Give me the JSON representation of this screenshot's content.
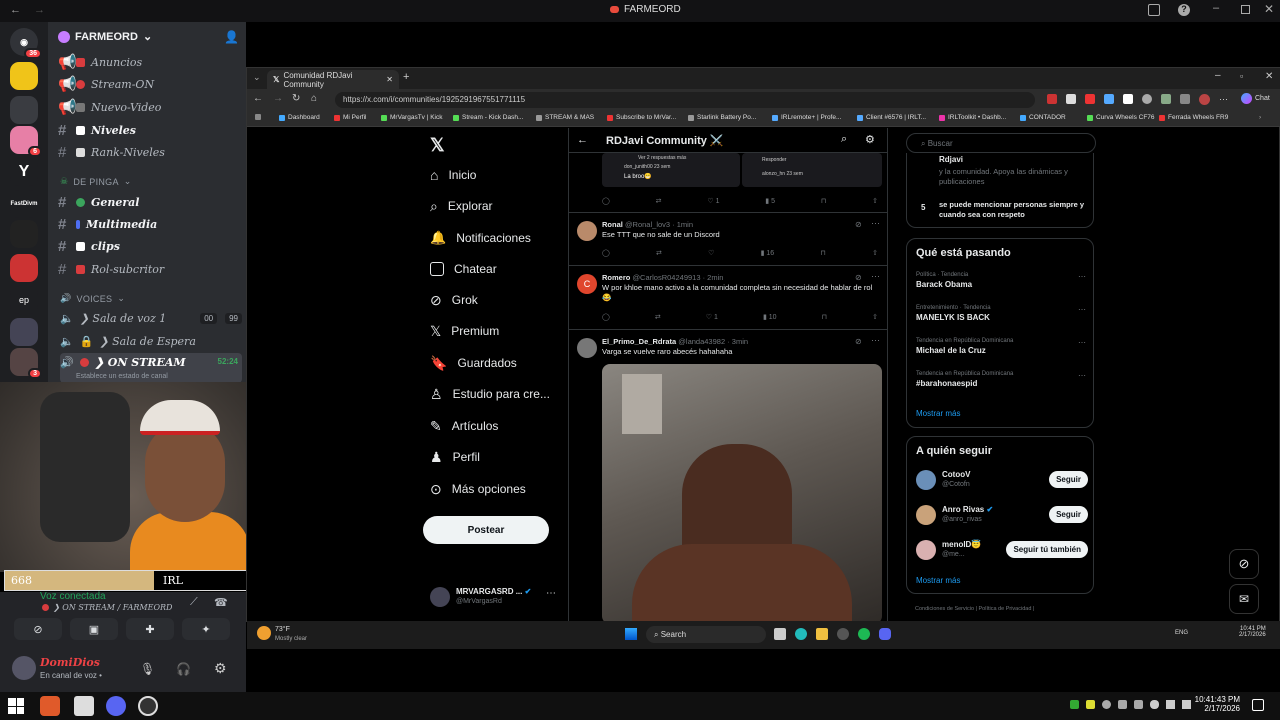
{
  "window": {
    "title": "FARMEORD"
  },
  "discord": {
    "server_name": "FARMEORD",
    "servers": [
      {
        "badge": "36"
      },
      {
        "badge": ""
      },
      {
        "badge": ""
      },
      {
        "badge": "6"
      },
      {
        "badge": ""
      },
      {
        "badge": ""
      },
      {
        "badge": ""
      },
      {
        "badge": ""
      },
      {
        "badge": ""
      },
      {
        "badge": ""
      },
      {
        "badge": "3"
      }
    ],
    "server_texts": {
      "ep": "ep",
      "fast": "FastDivm"
    },
    "channels": [
      {
        "name": "Anuncios",
        "emoji_color": "#d83c3e"
      },
      {
        "name": "Stream-ON",
        "emoji_color": "#d83c3e"
      },
      {
        "name": "Nuevo-Video",
        "emoji_color": "#aaaaaa"
      },
      {
        "name": "Niveles",
        "emoji_color": "#ffffff",
        "bold": true
      },
      {
        "name": "Rank-Niveles",
        "emoji_color": "#ffffff"
      }
    ],
    "category1": "DE PINGA",
    "channels2": [
      {
        "name": "General",
        "emoji_color": "#3ba55d",
        "bold": true
      },
      {
        "name": "Multimedia",
        "emoji_color": "#4e6ef2",
        "bold": true
      },
      {
        "name": "clips",
        "emoji_color": "#ffffff",
        "bold": true
      },
      {
        "name": "Rol-subcritor",
        "emoji_color": "#d83c3e"
      }
    ],
    "category2": "VOICES",
    "voice": [
      {
        "name": "❯ Sala de voz 1",
        "pill1": "00",
        "pill2": "99"
      },
      {
        "name": "❯ Sala de Espera"
      },
      {
        "name": "❯ ON STREAM",
        "time": "52:24",
        "status": "Establece un estado de canal"
      }
    ],
    "voice_status": "Voz conectada",
    "voice_channel": "❯ ON STREAM / FARMEORD",
    "user_name": "DomiDios",
    "user_status": "En canal de voz •"
  },
  "progress": {
    "left": "668",
    "center": "IRL",
    "right": "1000",
    "value": 668,
    "max": 1000
  },
  "browser": {
    "tab_title": "Comunidad RDJavi Community",
    "url": "https://x.com/i/communities/1925291967551771115",
    "chat": "Chat",
    "bookmarks": [
      "Dashboard",
      "Mi Perfil",
      "MrVargasTv | Kick",
      "Stream - Kick Dash...",
      "STREAM & MAS",
      "Subscribe to MrVar...",
      "Starlink Battery Po...",
      "IRLremote+ | Profe...",
      "Client #6576 | IRLT...",
      "IRLToolkit • Dashb...",
      "CONTADOR",
      "Curva Wheels CF76",
      "Ferrada Wheels FR9"
    ]
  },
  "x": {
    "nav": [
      "Inicio",
      "Explorar",
      "Notificaciones",
      "Chatear",
      "Grok",
      "Premium",
      "Guardados",
      "Estudio para cre...",
      "Artículos",
      "Perfil",
      "Más opciones"
    ],
    "post_button": "Postear",
    "account_name": "MRVARGASRD ...",
    "account_handle": "@MrVargasRd",
    "community_title": "RDJavi Community ⚔️",
    "top_preview": {
      "replies": "Ver 2 respuestas más",
      "u1": "don_junith00 23 sem",
      "t1": "La broo😁",
      "u2": "alonzo_hn 23 sem",
      "resp": "Responder",
      "likes": "1",
      "views": "5"
    },
    "tweets": [
      {
        "name": "Ronal",
        "handle": "@Ronal_lov3 · 1min",
        "text": "Ese TTT que no sale de un Discord",
        "likes": "",
        "views": "16"
      },
      {
        "name": "Romero",
        "handle": "@CarlosR04249913 · 2min",
        "text": "W por khloe mano activo a la comunidad completa sin necesidad de hablar de rol 😂",
        "likes": "1",
        "views": "10"
      },
      {
        "name": "El_Primo_De_Rdrata",
        "handle": "@landa43982 · 3min",
        "text": "Varga se vuelve raro abecés hahahaha"
      }
    ],
    "search_placeholder": "Buscar",
    "rules": {
      "r_name": "Rdjavi",
      "r_text": "y la comunidad. Apoya las dinámicas y publicaciones",
      "num": "5",
      "rule5": "se puede mencionar personas siempre y cuando sea con respeto"
    },
    "trending_title": "Qué está pasando",
    "trends": [
      {
        "cat": "Política · Tendencia",
        "name": "Barack Obama"
      },
      {
        "cat": "Entretenimiento · Tendencia",
        "name": "MANELYK IS BACK"
      },
      {
        "cat": "Tendencia en República Dominicana",
        "name": "Michael de la Cruz"
      },
      {
        "cat": "Tendencia en República Dominicana",
        "name": "#barahonaespid"
      }
    ],
    "show_more": "Mostrar más",
    "wtf_title": "A quién seguir",
    "wtf": [
      {
        "name": "CotooV",
        "handle": "@Cotofn",
        "btn": "Seguir"
      },
      {
        "name": "Anro Rivas",
        "handle": "@anro_rivas",
        "btn": "Seguir"
      },
      {
        "name": "menolD😇",
        "handle": "@me...",
        "btn": "Seguir tú también"
      }
    ],
    "show_more2": "Mostrar más",
    "footer": "Condiciones de Servicio  |  Política de Privacidad  |"
  },
  "inner_taskbar": {
    "temp": "73°F",
    "weather": "Mostly clear",
    "search": "Search",
    "lang": "ENG",
    "time": "10:41 PM",
    "date": "2/17/2026"
  },
  "taskbar": {
    "time": "10:41:43 PM",
    "date": "2/17/2026"
  }
}
